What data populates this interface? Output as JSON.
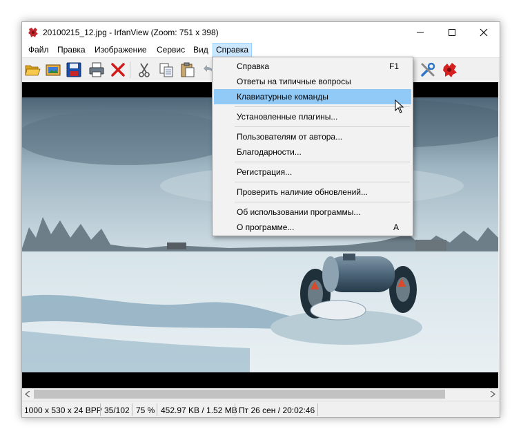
{
  "window": {
    "title": "20100215_12.jpg - IrfanView (Zoom: 751 x 398)",
    "minimize_glyph": "—",
    "maximize_glyph": "☐",
    "close_glyph": "✕"
  },
  "menubar": {
    "items": [
      "Файл",
      "Правка",
      "Изображение",
      "Сервис",
      "Вид",
      "Справка"
    ],
    "open_item": "Справка"
  },
  "toolbar": {
    "icons": [
      "open-folder-icon",
      "thumbnails-icon",
      "save-icon",
      "print-icon",
      "delete-icon",
      "cut-icon",
      "copy-icon",
      "paste-icon",
      "undo-icon",
      "settings-icon",
      "irfanview-logo-icon"
    ]
  },
  "help_menu": {
    "items": [
      {
        "label": "Справка",
        "shortcut": "F1"
      },
      {
        "label": "Ответы на типичные вопросы",
        "shortcut": ""
      },
      {
        "label": "Клавиатурные команды",
        "shortcut": "",
        "highlighted": true
      },
      {
        "label": "Установленные плагины...",
        "shortcut": ""
      },
      {
        "label": "Пользователям от автора...",
        "shortcut": ""
      },
      {
        "label": "Благодарности...",
        "shortcut": ""
      },
      {
        "label": "Регистрация...",
        "shortcut": ""
      },
      {
        "label": "Проверить наличие обновлений...",
        "shortcut": ""
      },
      {
        "label": "Об использовании программы...",
        "shortcut": ""
      },
      {
        "label": "О программе...",
        "shortcut": "A"
      }
    ]
  },
  "statusbar": {
    "dimensions": "1000 x 530 x 24 BPP",
    "index": "35/102",
    "zoom": "75 %",
    "size": "452.97 KB / 1.52 MB",
    "date": "Пт 26 сен / 20:02:46"
  },
  "colors": {
    "highlight": "#91c9f7",
    "menu_open_bg": "#cce8ff",
    "window_bg": "#f0f0f0"
  }
}
